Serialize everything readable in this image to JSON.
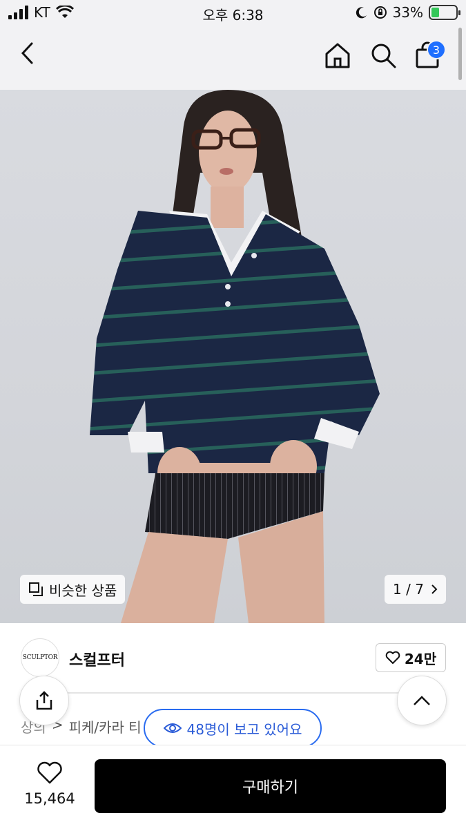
{
  "status_bar": {
    "carrier": "KT",
    "time": "오후 6:38",
    "battery": "33%",
    "battery_level": 0.33
  },
  "nav": {
    "cart_count": "3"
  },
  "hero": {
    "similar_label": "비슷한 상품",
    "page_indicator": "1 / 7"
  },
  "brand": {
    "logo_text": "SCULPTOR",
    "name": "스컬프터",
    "likes": "24만"
  },
  "breadcrumb": {
    "items": [
      "상의",
      "피케/카라 티"
    ]
  },
  "viewers_badge": "48명이 보고 있어요",
  "bottom_bar": {
    "wish_count": "15,464",
    "buy_label": "구매하기"
  }
}
